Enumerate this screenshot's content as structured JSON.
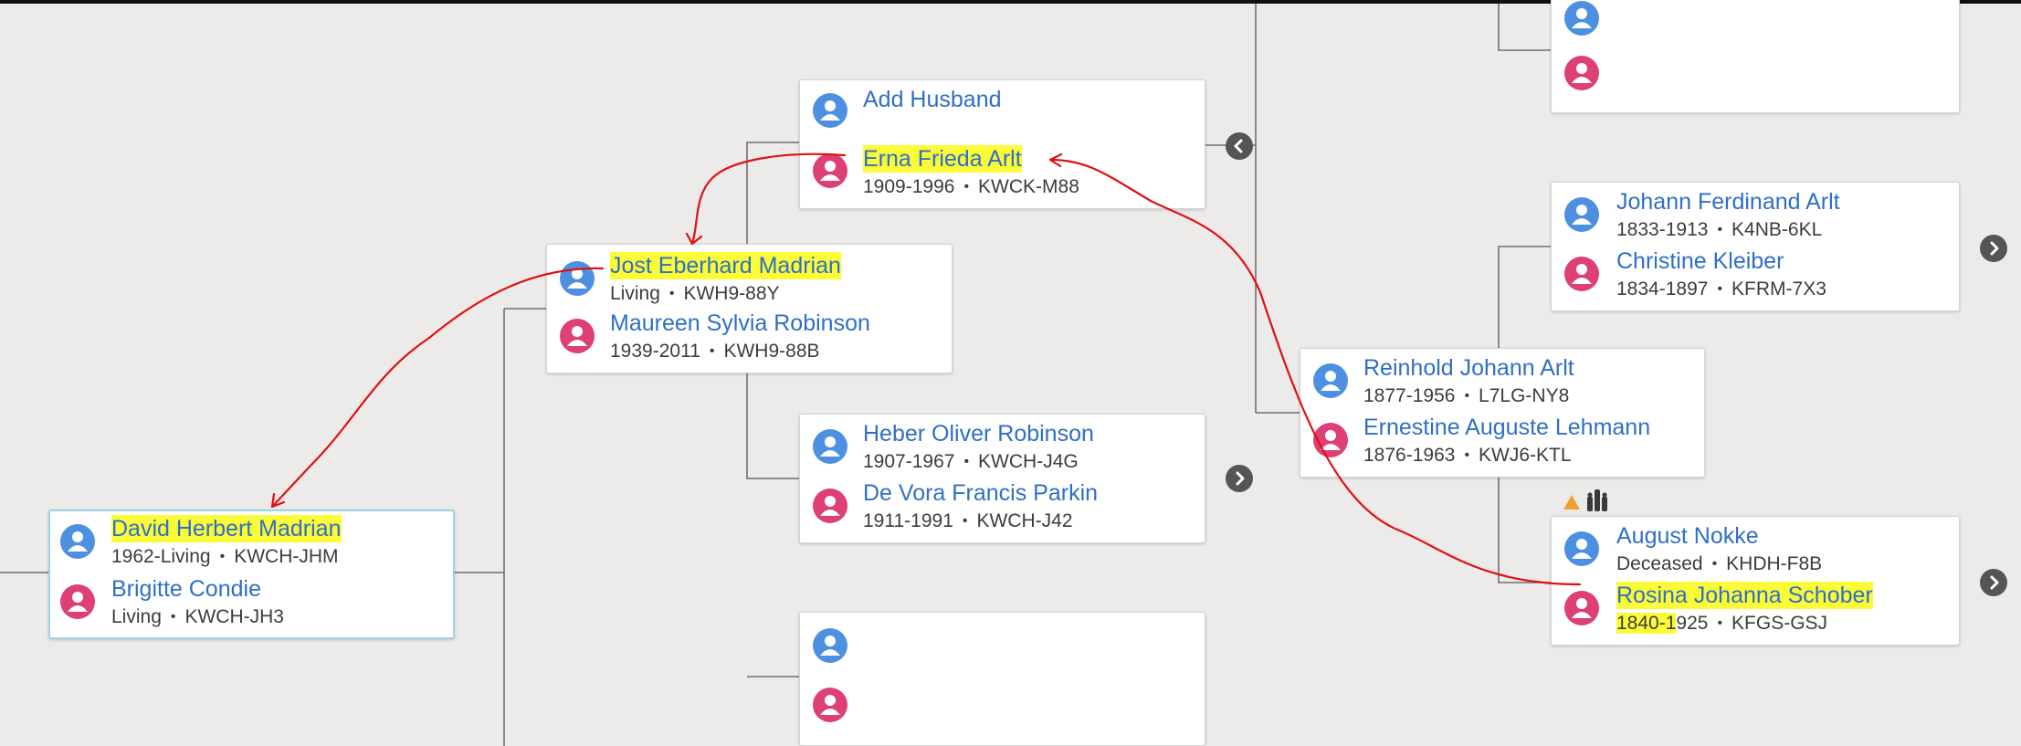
{
  "cards": {
    "david": {
      "husband": {
        "name": "David Herbert Madrian",
        "info_pre": "1962-Living",
        "id": "KWCH-JHM"
      },
      "wife": {
        "name": "Brigitte Condie",
        "info_pre": "Living",
        "id": "KWCH-JH3"
      }
    },
    "jost": {
      "husband": {
        "name": "Jost Eberhard Madrian",
        "info_pre": "Living",
        "id": "KWH9-88Y"
      },
      "wife": {
        "name": "Maureen Sylvia Robinson",
        "info_pre": "1939-2011",
        "id": "KWH9-88B"
      }
    },
    "erna": {
      "husband": {
        "name": "Add Husband"
      },
      "wife": {
        "name": "Erna Frieda Arlt",
        "info_pre": "1909-1996",
        "id": "KWCK-M88"
      }
    },
    "heber": {
      "husband": {
        "name": "Heber Oliver Robinson",
        "info_pre": "1907-1967",
        "id": "KWCH-J4G"
      },
      "wife": {
        "name": "De Vora Francis Parkin",
        "info_pre": "1911-1991",
        "id": "KWCH-J42"
      }
    },
    "reinhold": {
      "husband": {
        "name": "Reinhold Johann Arlt",
        "info_pre": "1877-1956",
        "id": "L7LG-NY8"
      },
      "wife": {
        "name": "Ernestine Auguste Lehmann",
        "info_pre": "1876-1963",
        "id": "KWJ6-KTL"
      }
    },
    "johann": {
      "husband": {
        "name": "Johann Ferdinand Arlt",
        "info_pre": "1833-1913",
        "id": "K4NB-6KL"
      },
      "wife": {
        "name": "Christine Kleiber",
        "info_pre": "1834-1897",
        "id": "KFRM-7X3"
      }
    },
    "august": {
      "husband": {
        "name": "August Nokke",
        "info_pre": "Deceased",
        "id": "KHDH-F8B"
      },
      "wife": {
        "name": "Rosina Johanna Schober",
        "info_hl": "1840-1",
        "info_rest": "925",
        "id": "KFGS-GSJ"
      }
    }
  },
  "icons": {
    "male_person": "person-icon",
    "female_person": "person-icon",
    "expand": "chevron-left-icon",
    "more": "chevron-right-icon",
    "warning": "warning-triangle-icon",
    "records": "record-hints-icon"
  },
  "colors": {
    "male": "#4d90e2",
    "female": "#dd3f76",
    "link": "#2f6fc6",
    "highlight": "#fbfb37",
    "annotation": "#e01010"
  }
}
